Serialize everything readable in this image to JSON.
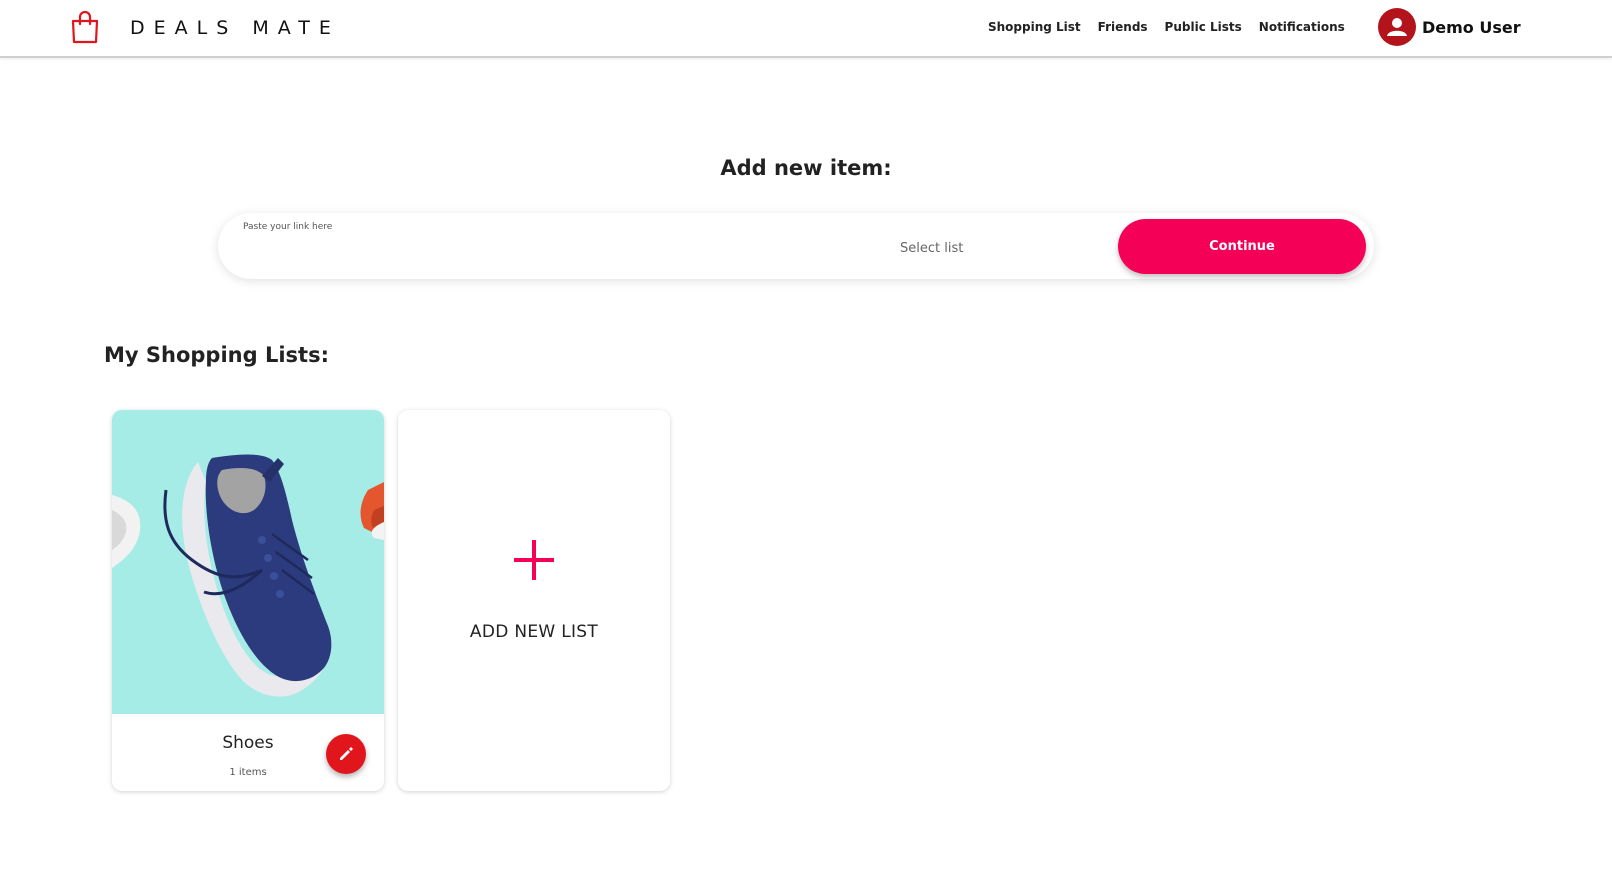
{
  "header": {
    "brand": "DEALS MATE",
    "nav": [
      "Shopping List",
      "Friends",
      "Public Lists",
      "Notifications"
    ],
    "user_name": "Demo User"
  },
  "add_item": {
    "title": "Add new item:",
    "link_label": "Paste your link here",
    "link_value": "",
    "select_value": "Select list",
    "continue_label": "Continue"
  },
  "lists": {
    "title": "My Shopping Lists:",
    "items": [
      {
        "name": "Shoes",
        "count": "1 items"
      }
    ],
    "add_new_label": "ADD NEW LIST"
  },
  "colors": {
    "accent": "#f50057",
    "brand_red": "#e0161c",
    "avatar": "#b3141b",
    "card_image_bg": "#a6ece6"
  },
  "icons": [
    "shopping-bag-icon",
    "user-avatar-icon",
    "dropdown-caret-icon",
    "pencil-icon",
    "plus-icon",
    "shoe-image"
  ]
}
